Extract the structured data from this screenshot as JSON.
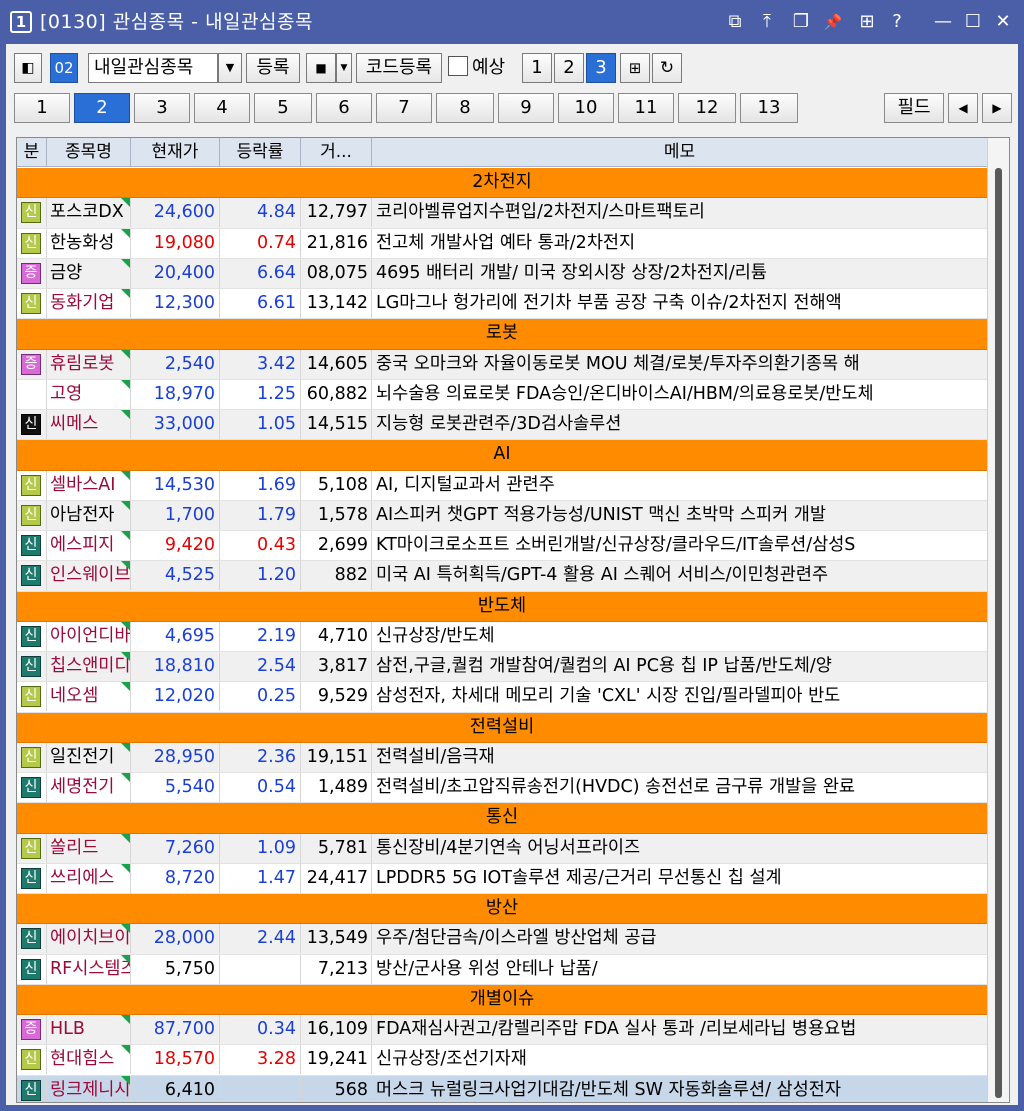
{
  "window": {
    "num": "1",
    "title": "[0130] 관심종목 - 내일관심종목",
    "controls": [
      "⧉",
      "⤒",
      "❐",
      "📌",
      "⊞",
      "?",
      "—",
      "☐",
      "✕"
    ]
  },
  "toolbar": {
    "group_code": "02",
    "group_name": "내일관심종목",
    "register": "등록",
    "code_register": "코드등록",
    "expect": "예상",
    "views": [
      "1",
      "2",
      "3"
    ]
  },
  "tabs": [
    "1",
    "2",
    "3",
    "4",
    "5",
    "6",
    "7",
    "8",
    "9",
    "10",
    "11",
    "12",
    "13"
  ],
  "field_button": "필드",
  "columns": [
    "분",
    "종목명",
    "현재가",
    "등락률",
    "거...",
    "메모"
  ],
  "colors": {
    "up": "#e60000",
    "down": "#1a3fd6",
    "name": "#9a0b3a",
    "category_bg": "#ff8c00"
  },
  "rows": [
    {
      "type": "cat",
      "label": "2차전지"
    },
    {
      "type": "stock",
      "badge": "신",
      "badge_style": "lime",
      "name": "포스코DX",
      "name_color": "#000",
      "price": "24,600",
      "rate": "4.84",
      "color": "#1a3fd6",
      "vol": "12,797",
      "memo": "코리아벨류업지수편입/2차전지/스마트팩토리"
    },
    {
      "type": "stock",
      "badge": "신",
      "badge_style": "lime",
      "name": "한농화성",
      "name_color": "#000",
      "price": "19,080",
      "rate": "0.74",
      "color": "#e60000",
      "vol": "21,816",
      "memo": "전고체 개발사업 예타 통과/2차전지"
    },
    {
      "type": "stock",
      "badge": "증",
      "badge_style": "pink",
      "name": "금양",
      "name_color": "#000",
      "price": "20,400",
      "rate": "6.64",
      "color": "#1a3fd6",
      "vol": "08,075",
      "memo": "4695 배터리 개발/ 미국 장외시장 상장/2차전지/리튬"
    },
    {
      "type": "stock",
      "badge": "신",
      "badge_style": "lime",
      "name": "동화기업",
      "name_color": "#9a0b3a",
      "price": "12,300",
      "rate": "6.61",
      "color": "#1a3fd6",
      "vol": "13,142",
      "memo": "LG마그나 헝가리에 전기차 부품 공장 구축 이슈/2차전지 전해액"
    },
    {
      "type": "cat",
      "label": "로봇"
    },
    {
      "type": "stock",
      "badge": "증",
      "badge_style": "pink",
      "name": "휴림로봇",
      "name_color": "#9a0b3a",
      "price": "2,540",
      "rate": "3.42",
      "color": "#1a3fd6",
      "vol": "14,605",
      "memo": "중국 오마크와 자율이동로봇 MOU 체결/로봇/투자주의환기종목 해"
    },
    {
      "type": "stock",
      "badge": "",
      "badge_style": "none",
      "name": "고영",
      "name_color": "#9a0b3a",
      "price": "18,970",
      "rate": "1.25",
      "color": "#1a3fd6",
      "vol": "60,882",
      "memo": "뇌수술용 의료로봇 FDA승인/온디바이스AI/HBM/의료용로봇/반도체"
    },
    {
      "type": "stock",
      "badge": "신",
      "badge_style": "black",
      "name": "씨메스",
      "name_color": "#9a0b3a",
      "price": "33,000",
      "rate": "1.05",
      "color": "#1a3fd6",
      "vol": "14,515",
      "memo": "지능형 로봇관련주/3D검사솔루션"
    },
    {
      "type": "cat",
      "label": "AI"
    },
    {
      "type": "stock",
      "badge": "신",
      "badge_style": "lime",
      "name": "셀바스AI",
      "name_color": "#9a0b3a",
      "price": "14,530",
      "rate": "1.69",
      "color": "#1a3fd6",
      "vol": "5,108",
      "memo": "AI, 디지털교과서 관련주"
    },
    {
      "type": "stock",
      "badge": "신",
      "badge_style": "lime",
      "name": "아남전자",
      "name_color": "#000",
      "price": "1,700",
      "rate": "1.79",
      "color": "#1a3fd6",
      "vol": "1,578",
      "memo": "AI스피커 챗GPT 적용가능성/UNIST 맥신 초박막 스피커 개발"
    },
    {
      "type": "stock",
      "badge": "신",
      "badge_style": "teal",
      "name": "에스피지",
      "name_color": "#9a0b3a",
      "price": "9,420",
      "rate": "0.43",
      "color": "#e60000",
      "vol": "2,699",
      "memo": "KT마이크로소프트 소버린개발/신규상장/클라우드/IT솔루션/삼성S"
    },
    {
      "type": "stock",
      "badge": "신",
      "badge_style": "teal",
      "name": "인스웨이브",
      "name_color": "#9a0b3a",
      "price": "4,525",
      "rate": "1.20",
      "color": "#1a3fd6",
      "vol": "882",
      "memo": "미국 AI 특허획득/GPT-4 활용 AI 스퀘어 서비스/이민청관련주"
    },
    {
      "type": "cat",
      "label": "반도체"
    },
    {
      "type": "stock",
      "badge": "신",
      "badge_style": "teal",
      "name": "아이언디바이스",
      "name_color": "#9a0b3a",
      "price": "4,695",
      "rate": "2.19",
      "color": "#1a3fd6",
      "vol": "4,710",
      "memo": "신규상장/반도체"
    },
    {
      "type": "stock",
      "badge": "신",
      "badge_style": "teal",
      "name": "칩스앤미디어",
      "name_color": "#9a0b3a",
      "price": "18,810",
      "rate": "2.54",
      "color": "#1a3fd6",
      "vol": "3,817",
      "memo": "삼전,구글,퀄컴 개발참여/퀄컴의 AI PC용 칩 IP 납품/반도체/양"
    },
    {
      "type": "stock",
      "badge": "신",
      "badge_style": "lime",
      "name": "네오셈",
      "name_color": "#9a0b3a",
      "price": "12,020",
      "rate": "0.25",
      "color": "#1a3fd6",
      "vol": "9,529",
      "memo": "삼성전자, 차세대 메모리 기술 'CXL' 시장 진입/필라델피아 반도"
    },
    {
      "type": "cat",
      "label": "전력설비"
    },
    {
      "type": "stock",
      "badge": "신",
      "badge_style": "lime",
      "name": "일진전기",
      "name_color": "#000",
      "price": "28,950",
      "rate": "2.36",
      "color": "#1a3fd6",
      "vol": "19,151",
      "memo": "전력설비/음극재"
    },
    {
      "type": "stock",
      "badge": "신",
      "badge_style": "teal",
      "name": "세명전기",
      "name_color": "#9a0b3a",
      "price": "5,540",
      "rate": "0.54",
      "color": "#1a3fd6",
      "vol": "1,489",
      "memo": "전력설비/초고압직류송전기(HVDC) 송전선로 금구류 개발을 완료"
    },
    {
      "type": "cat",
      "label": "통신"
    },
    {
      "type": "stock",
      "badge": "신",
      "badge_style": "lime",
      "name": "쏠리드",
      "name_color": "#9a0b3a",
      "price": "7,260",
      "rate": "1.09",
      "color": "#1a3fd6",
      "vol": "5,781",
      "memo": "통신장비/4분기연속 어닝서프라이즈"
    },
    {
      "type": "stock",
      "badge": "신",
      "badge_style": "teal",
      "name": "쓰리에스",
      "name_color": "#9a0b3a",
      "price": "8,720",
      "rate": "1.47",
      "color": "#1a3fd6",
      "vol": "24,417",
      "memo": "LPDDR5 5G IOT솔루션 제공/근거리 무선통신 칩 설계"
    },
    {
      "type": "cat",
      "label": "방산"
    },
    {
      "type": "stock",
      "badge": "신",
      "badge_style": "teal",
      "name": "에이치브이엠",
      "name_color": "#9a0b3a",
      "price": "28,000",
      "rate": "2.44",
      "color": "#1a3fd6",
      "vol": "13,549",
      "memo": "우주/첨단금속/이스라엘 방산업체 공급"
    },
    {
      "type": "stock",
      "badge": "신",
      "badge_style": "teal",
      "name": "RF시스템즈",
      "name_color": "#9a0b3a",
      "price": "5,750",
      "rate": "",
      "color": "#000",
      "vol": "7,213",
      "memo": "방산/군사용 위성 안테나 납품/"
    },
    {
      "type": "cat",
      "label": "개별이슈"
    },
    {
      "type": "stock",
      "badge": "증",
      "badge_style": "pink",
      "name": "HLB",
      "name_color": "#9a0b3a",
      "price": "87,700",
      "rate": "0.34",
      "color": "#1a3fd6",
      "vol": "16,109",
      "memo": "FDA재심사권고/캄렐리주맙 FDA 실사 통과 /리보세라닙 병용요법"
    },
    {
      "type": "stock",
      "badge": "신",
      "badge_style": "lime",
      "name": "현대힘스",
      "name_color": "#9a0b3a",
      "price": "18,570",
      "rate": "3.28",
      "color": "#e60000",
      "vol": "19,241",
      "memo": "신규상장/조선기자재"
    },
    {
      "type": "stock",
      "badge": "신",
      "badge_style": "teal",
      "name": "링크제니시스",
      "name_color": "#9a0b3a",
      "price": "6,410",
      "rate": "",
      "color": "#000",
      "vol": "568",
      "memo": "머스크 뉴럴링크사업기대감/반도체 SW 자동화솔루션/ 삼성전자",
      "highlight": true
    }
  ]
}
